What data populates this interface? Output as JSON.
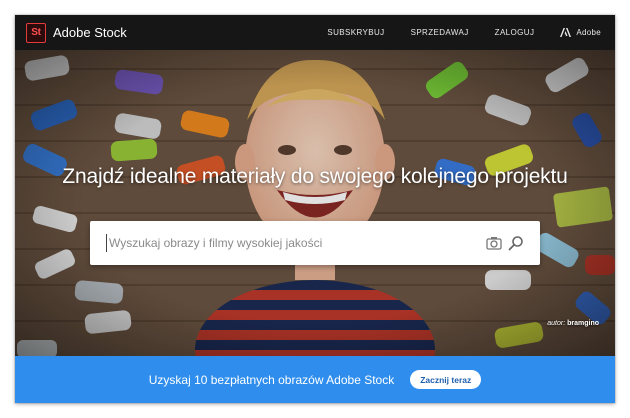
{
  "header": {
    "logo_text": "St",
    "brand": "Adobe Stock",
    "nav": [
      "SUBSKRYBUJ",
      "SPRZEDAWAJ",
      "ZALOGUJ"
    ],
    "adobe_label": "Adobe"
  },
  "hero": {
    "title": "Znajdź idealne materiały do swojego kolejnego projektu",
    "search_placeholder": "Wyszukaj obrazy i filmy wysokiej jakości",
    "camera_icon": "camera-icon",
    "search_icon": "search-icon",
    "credit_prefix": "autor:",
    "credit_name": "bramgino"
  },
  "promo": {
    "text": "Uzyskaj 10 bezpłatnych obrazów Adobe Stock",
    "button": "Zacznij teraz"
  },
  "colors": {
    "nav_bg": "#161616",
    "logo_red": "#e23b3b",
    "promo_blue": "#2f8eed",
    "button_text": "#1f5fae"
  }
}
